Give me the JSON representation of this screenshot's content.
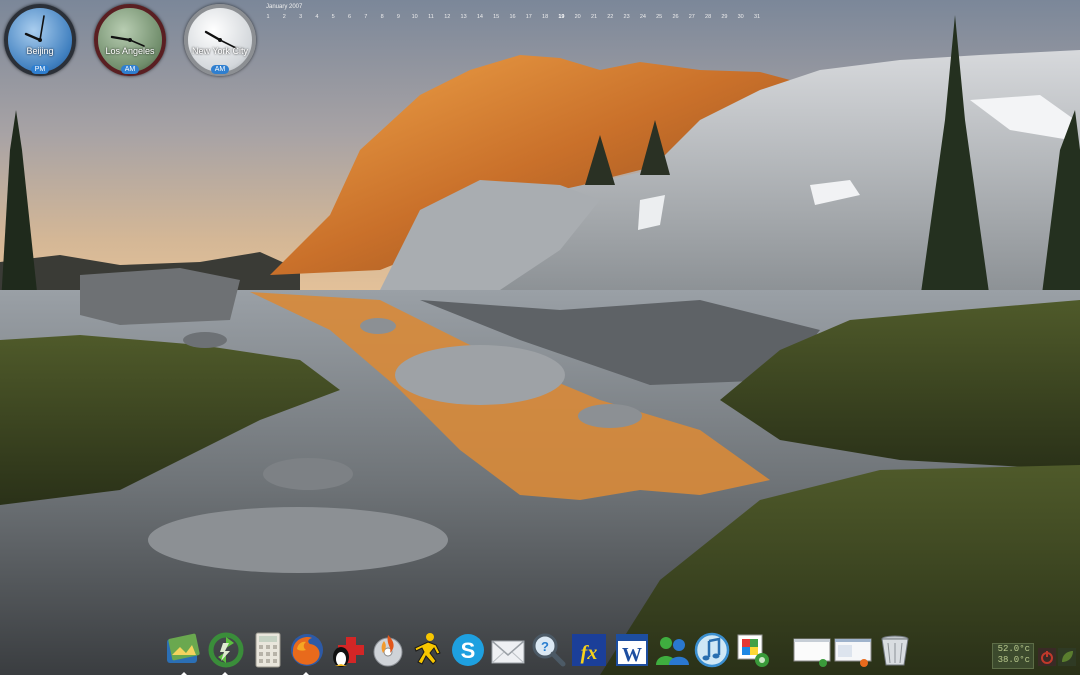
{
  "clocks": [
    {
      "city": "Beijing",
      "ampm": "PM",
      "accent": "#3d8bd6",
      "face_color": "#6fa6d8"
    },
    {
      "city": "Los Angeles",
      "ampm": "AM",
      "accent": "#8a2a2a",
      "face_color": "#7f9a7a"
    },
    {
      "city": "New York City",
      "ampm": "AM",
      "accent": "#9a9a9a",
      "face_color": "#d9dde0"
    }
  ],
  "calendar": {
    "title": "January 2007",
    "days": [
      "1",
      "2",
      "3",
      "4",
      "5",
      "6",
      "7",
      "8",
      "9",
      "10",
      "11",
      "12",
      "13",
      "14",
      "15",
      "16",
      "17",
      "18",
      "19",
      "20",
      "21",
      "22",
      "23",
      "24",
      "25",
      "26",
      "27",
      "28",
      "29",
      "30",
      "31"
    ],
    "today": "19"
  },
  "dock": {
    "items": [
      {
        "name": "photo-album-icon"
      },
      {
        "name": "sync-update-icon"
      },
      {
        "name": "calculator-icon"
      },
      {
        "name": "firefox-icon"
      },
      {
        "name": "tux-first-aid-icon"
      },
      {
        "name": "nero-burn-icon"
      },
      {
        "name": "aim-runner-icon"
      },
      {
        "name": "skype-icon"
      },
      {
        "name": "mail-envelope-icon"
      },
      {
        "name": "search-magnifier-icon"
      },
      {
        "name": "fx-icon"
      },
      {
        "name": "word-icon"
      },
      {
        "name": "msn-messenger-icon"
      },
      {
        "name": "itunes-icon"
      },
      {
        "name": "office-tools-icon"
      },
      {
        "name": "window-preview-1-icon"
      },
      {
        "name": "window-preview-firefox-icon"
      },
      {
        "name": "trash-bin-icon"
      }
    ]
  },
  "system_tray": {
    "temp_1": "52.0°c",
    "temp_2": "38.0°c"
  }
}
